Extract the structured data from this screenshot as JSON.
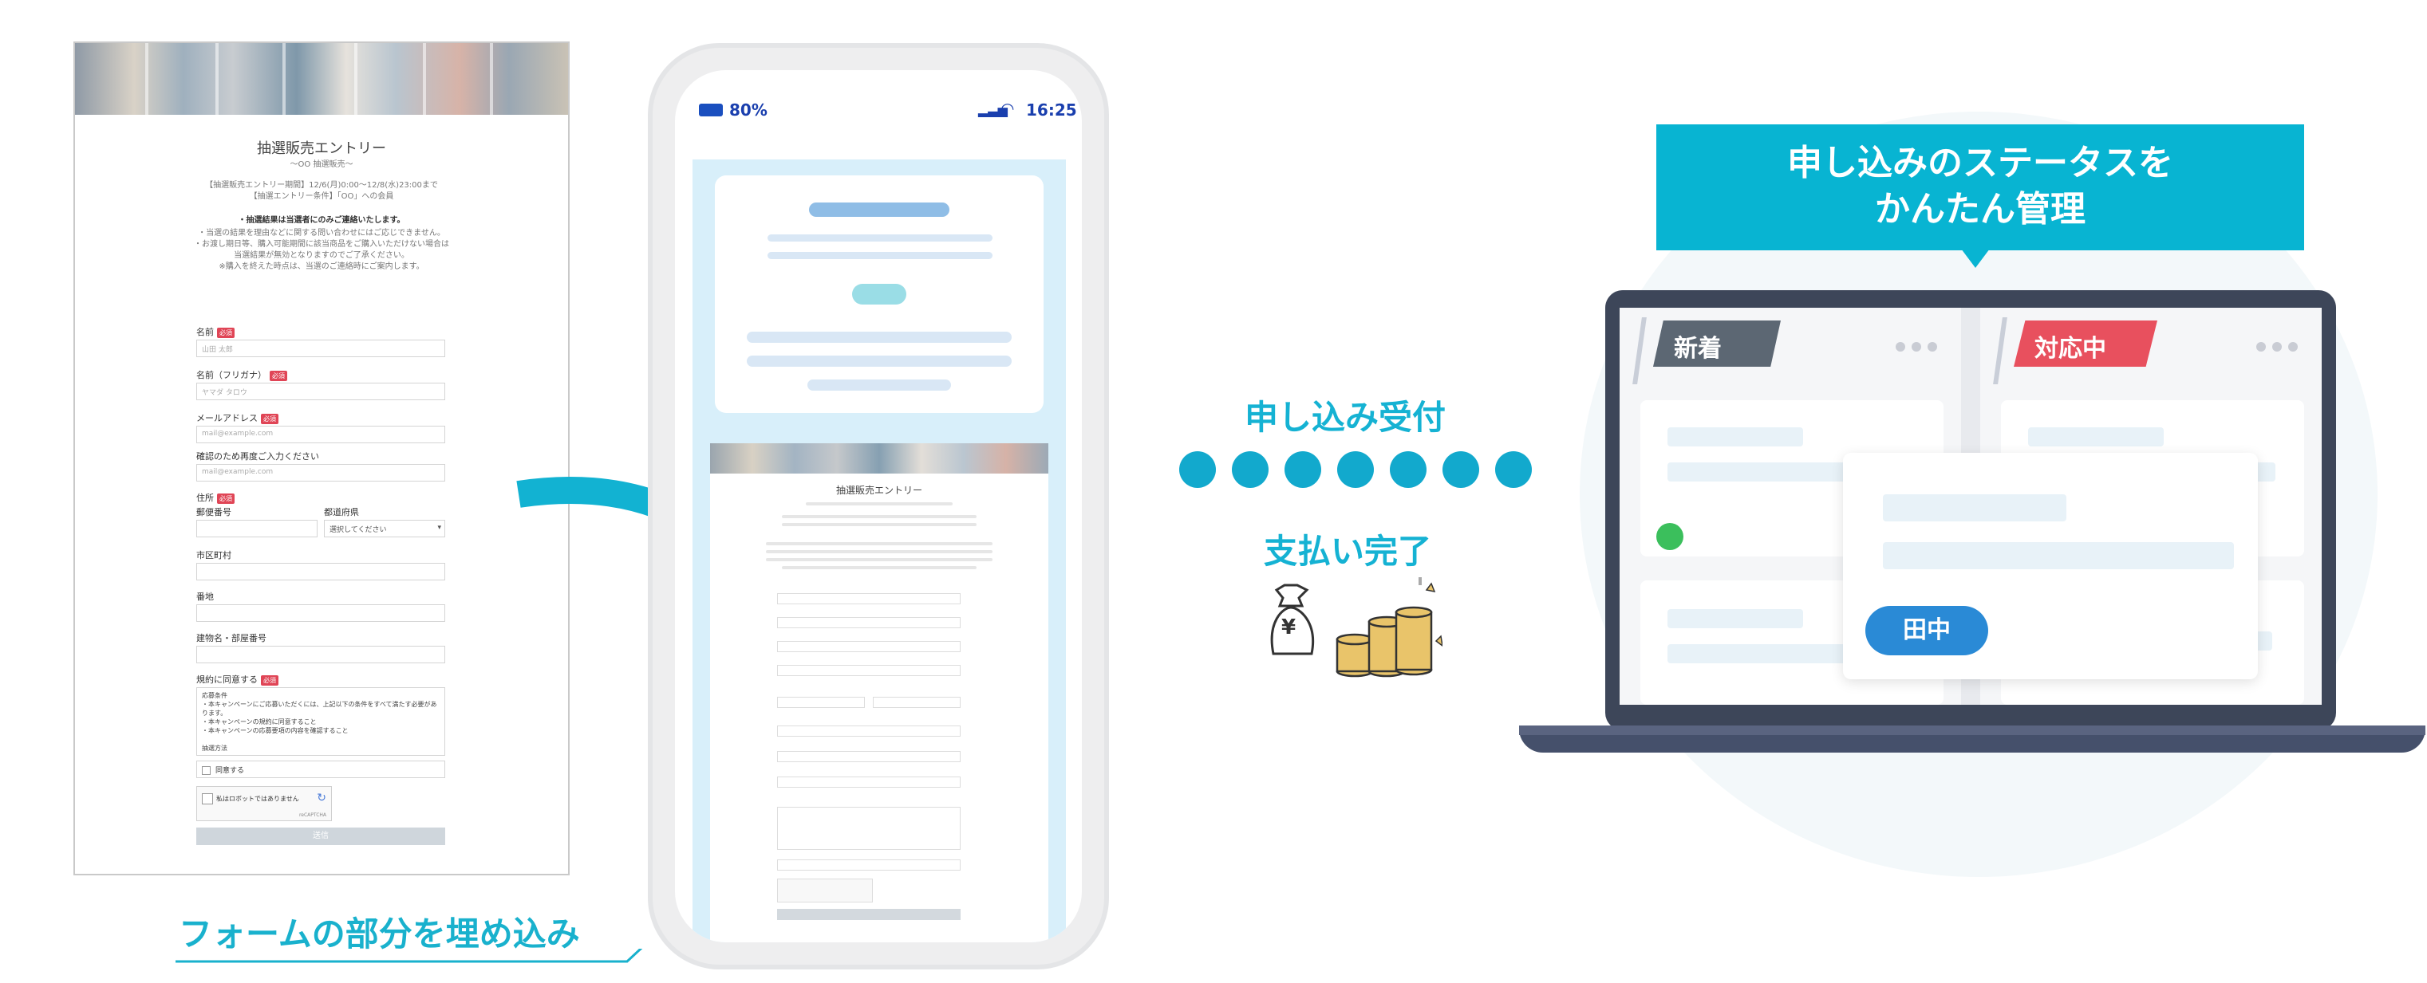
{
  "form": {
    "title": "抽選販売エントリー",
    "subtitle": "〜OO 抽選販売〜",
    "period_line1": "【抽選販売エントリー期間】12/6(月)0:00〜12/8(水)23:00まで",
    "period_line2": "【抽選エントリー条件】「OO」への会員",
    "notice_head": "・抽選結果は当選者にのみご連絡いたします。",
    "notice_lines": [
      "・当選の結果を理由などに関する問い合わせにはご応じできません。",
      "・お渡し期日等、購入可能期間に該当商品をご購入いただけない場合は",
      "当選結果が無効となりますのでご了承ください。",
      "※購入を終えた時点は、当選のご連絡時にご案内します。"
    ],
    "fields": [
      {
        "label": "名前",
        "required": "必須",
        "placeholder": "山田 太郎"
      },
      {
        "label": "名前（フリガナ）",
        "required": "必須",
        "placeholder": "ヤマダ タロウ"
      },
      {
        "label": "メールアドレス",
        "required": "必須",
        "placeholder": "mail@example.com"
      },
      {
        "label": "確認のため再度ご入力ください",
        "required": "",
        "placeholder": "mail@example.com"
      }
    ],
    "address_label": "住所",
    "address_required": "必須",
    "zip_label": "郵便番号",
    "pref_label": "都道府県",
    "pref_select": "選択してください",
    "city_label": "市区町村",
    "street_label": "番地",
    "building_label": "建物名・部屋番号",
    "terms_label": "規約に同意する",
    "terms_required": "必須",
    "terms_text": [
      "応募条件",
      "・本キャンペーンにご応募いただくには、上記以下の条件をすべて満たす必要があります。",
      "・本キャンペーンの規約に同意すること",
      "・本キャンペーンの応募要項の内容を確認すること",
      "",
      "抽選方法"
    ],
    "agree_label": "同意する",
    "captcha_label": "私はロボットではありません",
    "captcha_sub": "reCAPTCHA",
    "submit_label": "送信"
  },
  "phone": {
    "battery": "80%",
    "time": "16:25",
    "form_title": "抽選販売エントリー"
  },
  "caption": "フォームの部分を埋め込み",
  "flow": {
    "received": "申し込み受付",
    "paid": "支払い完了",
    "yen": "¥"
  },
  "bubble": {
    "line1": "申し込みのステータスを",
    "line2": "かんたん管理"
  },
  "board": {
    "col1_tag": "新着",
    "col2_tag": "対応中",
    "assignee": "田中"
  },
  "colors": {
    "accent": "#08b4d2",
    "tag_new": "#5c6773",
    "tag_in_progress": "#e8505e",
    "assignee": "#2a8ad6",
    "status_dot": "#3bbf5c"
  }
}
